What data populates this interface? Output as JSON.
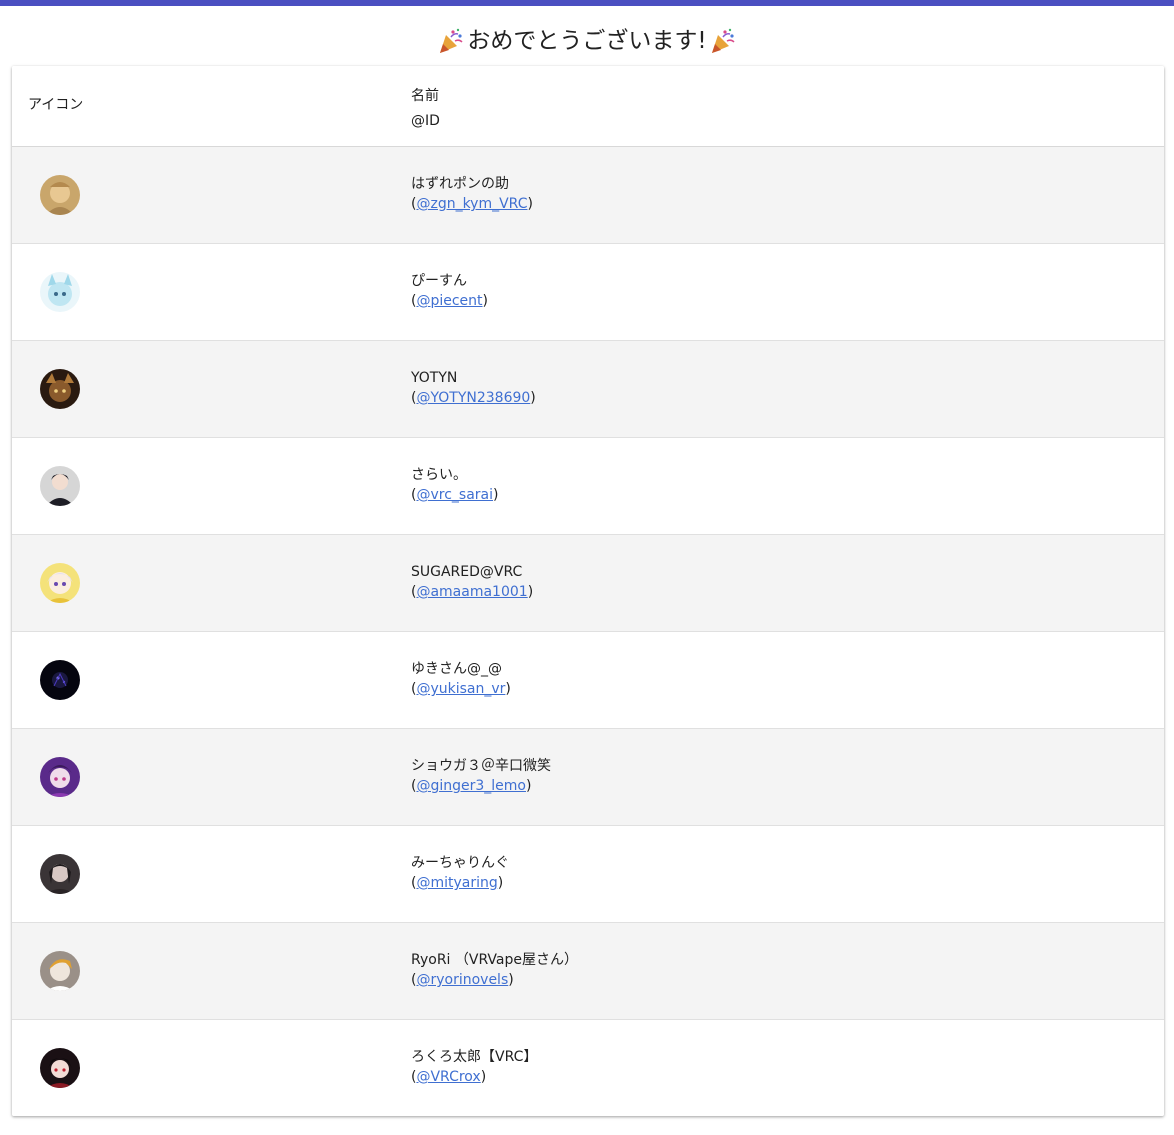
{
  "title": {
    "text": "おめでとうございます!"
  },
  "table": {
    "headers": {
      "icon": "アイコン",
      "name": "名前",
      "id": "@ID"
    },
    "rows": [
      {
        "name": "はずれポンの助",
        "open": "(",
        "id": "@zgn_kym_VRC",
        "close": ")"
      },
      {
        "name": "ぴーすん",
        "open": "(",
        "id": "@piecent",
        "close": ")"
      },
      {
        "name": "YOTYN",
        "open": "(",
        "id": "@YOTYN238690",
        "close": ")"
      },
      {
        "name": "さらい。",
        "open": "(",
        "id": "@vrc_sarai",
        "close": ")"
      },
      {
        "name": "SUGARED@VRC",
        "open": "(",
        "id": "@amaama1001",
        "close": ")"
      },
      {
        "name": "ゆきさん@_@",
        "open": "(",
        "id": "@yukisan_vr",
        "close": ")"
      },
      {
        "name": "ショウガ３＠辛口微笑",
        "open": "(",
        "id": "@ginger3_lemo",
        "close": ")"
      },
      {
        "name": "みーちゃりんぐ",
        "open": "(",
        "id": "@mityaring",
        "close": ")"
      },
      {
        "name": "RyoRi （VRVape屋さん）",
        "open": "(",
        "id": "@ryorinovels",
        "close": ")"
      },
      {
        "name": "ろくろ太郎【VRC】",
        "open": "(",
        "id": "@VRCrox",
        "close": ")"
      }
    ]
  },
  "colors": {
    "accent_bar": "#4b4fc1",
    "link": "#3f6fd1",
    "row_alt": "#f4f4f4"
  },
  "icons": {
    "title_left": "party-popper-icon",
    "title_right": "party-popper-icon"
  }
}
